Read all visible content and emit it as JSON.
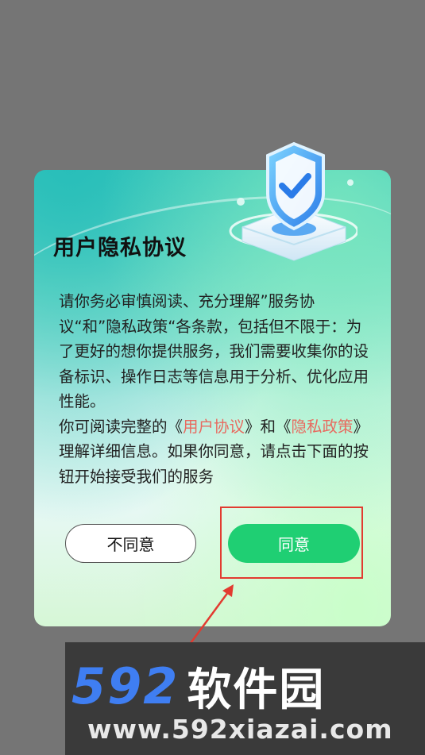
{
  "dialog": {
    "title": "用户隐私协议",
    "paragraph1": "  请你务必审慎阅读、充分理解”服务协议“和”隐私政策“各条款，包括但不限于：为了更好的想你提供服务，我们需要收集你的设备标识、操作日志等信息用于分析、优化应用性能。",
    "paragraph2_pre": "  你可阅读完整的《",
    "user_agreement_link": "用户协议",
    "paragraph2_mid": "》和《",
    "privacy_policy_link": "隐私政策",
    "paragraph2_post": "》理解详细信息。如果你同意，请点击下面的按钮开始接受我们的服务",
    "disagree_label": "不同意",
    "agree_label": "同意"
  },
  "watermark": {
    "logo_number": "592",
    "logo_text": "软件园",
    "url": "www.592xiazai.com"
  },
  "colors": {
    "background": "#757575",
    "agree_button": "#1fcf73",
    "link": "#e86a5f",
    "highlight_box": "#e23b30",
    "logo_blue": "#3f7ef2"
  },
  "icons": [
    "shield-check-icon",
    "annotation-arrow"
  ]
}
